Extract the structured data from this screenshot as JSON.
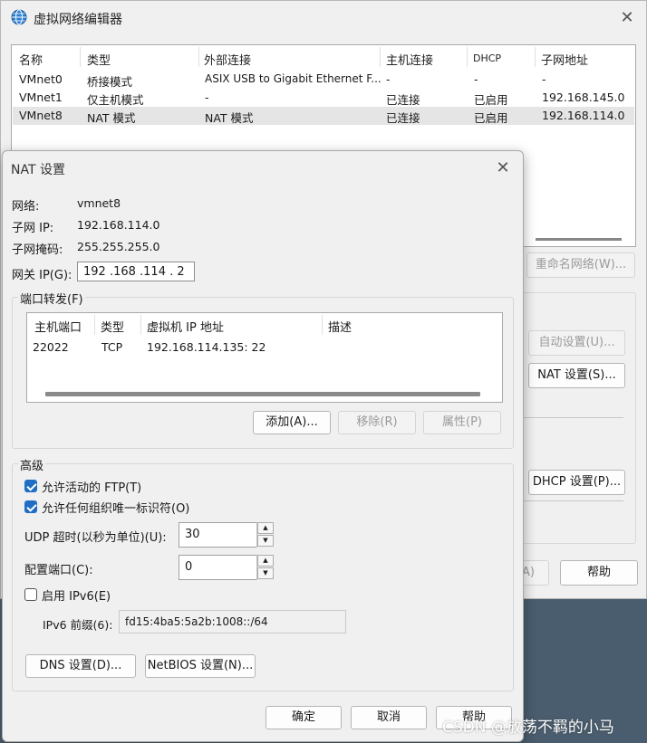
{
  "bg_dialog": {
    "title": "虚拟网络编辑器",
    "columns": [
      "名称",
      "类型",
      "外部连接",
      "主机连接",
      "DHCP",
      "子网地址"
    ],
    "rows": [
      [
        "VMnet0",
        "桥接模式",
        "ASIX USB to Gigabit Ethernet F...",
        "-",
        "-",
        "-"
      ],
      [
        "VMnet1",
        "仅主机模式",
        "-",
        "已连接",
        "已启用",
        "192.168.145.0"
      ],
      [
        "VMnet8",
        "NAT 模式",
        "NAT 模式",
        "已连接",
        "已启用",
        "192.168.114.0"
      ]
    ],
    "rename_button": "重命名网络(W)...",
    "auto_settings_button": "自动设置(U)...",
    "nat_settings_button": "NAT 设置(S)...",
    "dhcp_settings_button": "DHCP 设置(P)...",
    "partial_button": "A)",
    "help_button": "帮助"
  },
  "nat_dialog": {
    "title": "NAT 设置",
    "network_label": "网络:",
    "network_value": "vmnet8",
    "subnet_ip_label": "子网 IP:",
    "subnet_ip_value": "192.168.114.0",
    "subnet_mask_label": "子网掩码:",
    "subnet_mask_value": "255.255.255.0",
    "gateway_label": "网关 IP(G):",
    "gateway_value": "192 .168 .114 . 2",
    "port_forward": {
      "group_label": "端口转发(F)",
      "columns": [
        "主机端口",
        "类型",
        "虚拟机 IP 地址",
        "描述"
      ],
      "rows": [
        [
          "22022",
          "TCP",
          "192.168.114.135: 22",
          ""
        ]
      ],
      "add_button": "添加(A)...",
      "remove_button": "移除(R)",
      "properties_button": "属性(P)"
    },
    "advanced": {
      "group_label": "高级",
      "allow_ftp_label": "允许活动的 FTP(T)",
      "allow_ftp_checked": true,
      "allow_oui_label": "允许任何组织唯一标识符(O)",
      "allow_oui_checked": true,
      "udp_timeout_label": "UDP 超时(以秒为单位)(U):",
      "udp_timeout_value": "30",
      "config_port_label": "配置端口(C):",
      "config_port_value": "0",
      "enable_ipv6_label": "启用 IPv6(E)",
      "enable_ipv6_checked": false,
      "ipv6_prefix_label": "IPv6 前缀(6):",
      "ipv6_prefix_value": "fd15:4ba5:5a2b:1008::/64",
      "dns_button": "DNS 设置(D)...",
      "netbios_button": "NetBIOS 设置(N)..."
    },
    "ok_button": "确定",
    "cancel_button": "取消",
    "help_button": "帮助"
  },
  "watermark": "CSDN @放荡不羁的小马",
  "colors": {
    "accent": "#1f6ec4",
    "background": "#f0f0f0"
  }
}
